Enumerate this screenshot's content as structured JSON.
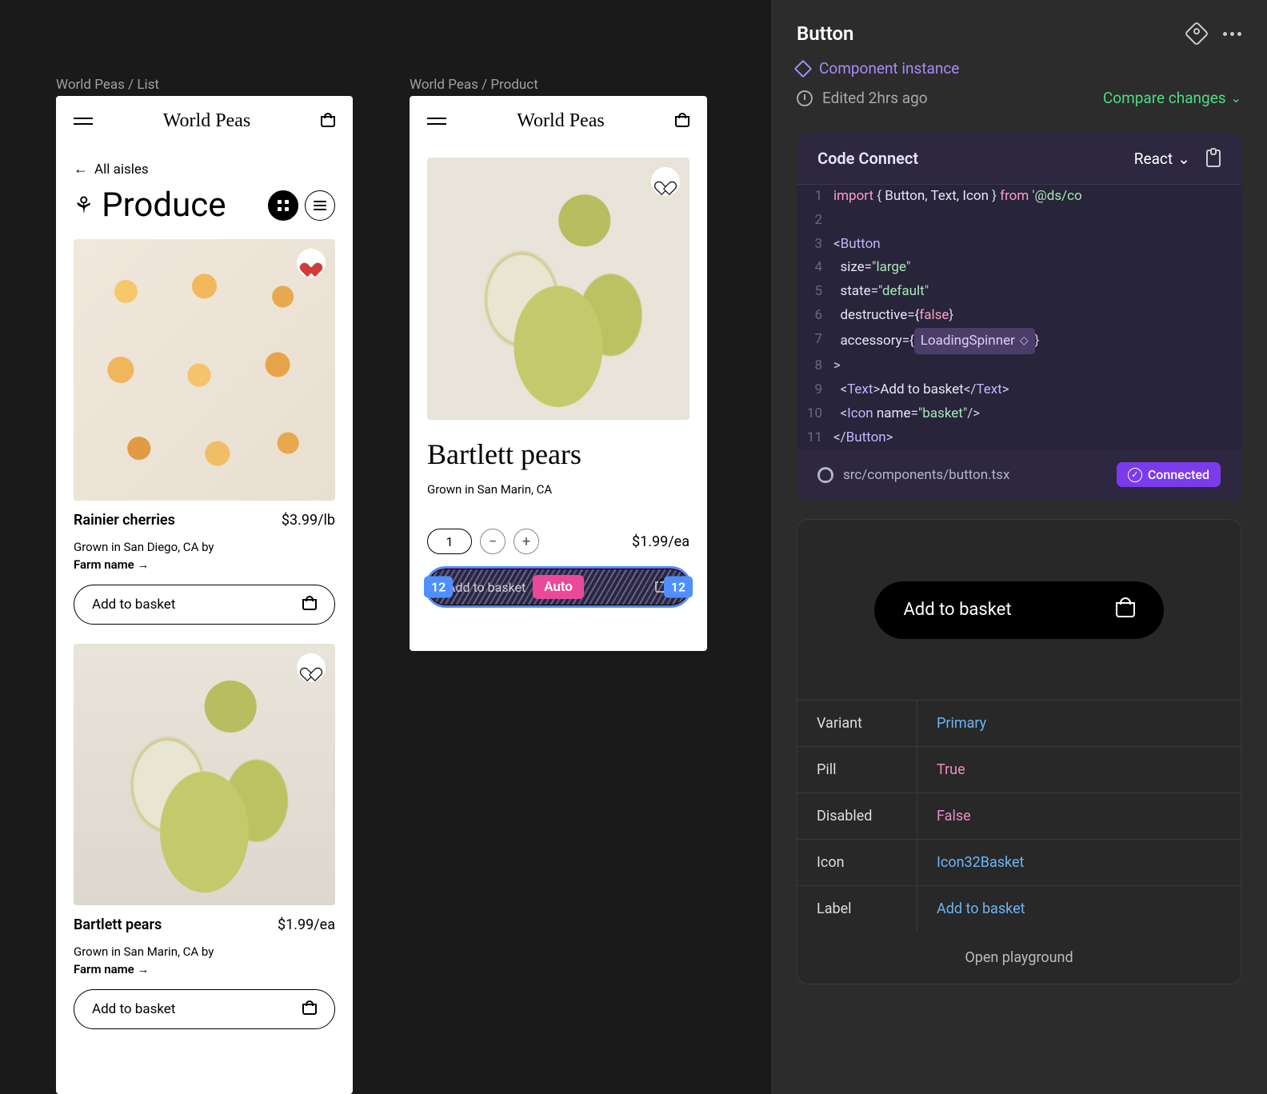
{
  "canvas": {
    "frame1_label": "World Peas / List",
    "frame2_label": "World Peas / Product",
    "brand": "World Peas",
    "back_link": "All aisles",
    "page_title": "Produce",
    "cards": [
      {
        "name": "Rainier cherries",
        "price": "$3.99/lb",
        "origin": "Grown in San Diego, CA by",
        "farm": "Farm name",
        "cta": "Add to basket",
        "favorite": true
      },
      {
        "name": "Bartlett pears",
        "price": "$1.99/ea",
        "origin": "Grown in San Marin, CA by",
        "farm": "Farm name",
        "cta": "Add to basket",
        "favorite": false
      }
    ],
    "product": {
      "title": "Bartlett pears",
      "origin": "Grown in San Marin, CA",
      "qty": "1",
      "price": "$1.99/ea",
      "cta": "Add to basket"
    },
    "overlay": {
      "left_pad": "12",
      "center": "Auto",
      "right_pad": "12"
    }
  },
  "panel": {
    "title": "Button",
    "instance_label": "Component instance",
    "edited": "Edited 2hrs ago",
    "compare": "Compare changes",
    "code_connect_title": "Code Connect",
    "framework": "React",
    "file_path": "src/components/button.tsx",
    "connected": "Connected",
    "code": {
      "l1_import": "import",
      "l1_braces": "{ ",
      "l1_ids": "Button, Text, Icon",
      "l1_braces2": " }",
      "l1_from": "from",
      "l1_pkg": "'@ds/co",
      "l3_open": "<",
      "l3_tag": "Button",
      "l4_attr": "size=",
      "l4_val": "\"large\"",
      "l5_attr": "state=",
      "l5_val": "\"default\"",
      "l6_attr": "destructive={",
      "l6_val": "false",
      "l6_close": "}",
      "l7_attr": "accessory={",
      "l7_chip": "LoadingSpinner",
      "l7_close": "}",
      "l8": ">",
      "l9_open": "<",
      "l9_tag": "Text",
      "l9_gt": ">",
      "l9_txt": "Add to basket",
      "l9_close_open": "</",
      "l9_close_gt": ">",
      "l10_open": "<",
      "l10_tag": "Icon",
      "l10_attr": " name=",
      "l10_val": "\"basket\"",
      "l10_close": "/>",
      "l11_open": "</",
      "l11_tag": "Button",
      "l11_close": ">"
    },
    "preview_label": "Add to basket",
    "props": [
      {
        "k": "Variant",
        "v": "Primary",
        "cls": "pv-link"
      },
      {
        "k": "Pill",
        "v": "True",
        "cls": "pv-pink"
      },
      {
        "k": "Disabled",
        "v": "False",
        "cls": "pv-pink"
      },
      {
        "k": "Icon",
        "v": "Icon32Basket",
        "cls": "pv-link"
      },
      {
        "k": "Label",
        "v": "Add to basket",
        "cls": "pv-link"
      }
    ],
    "playground": "Open playground"
  }
}
